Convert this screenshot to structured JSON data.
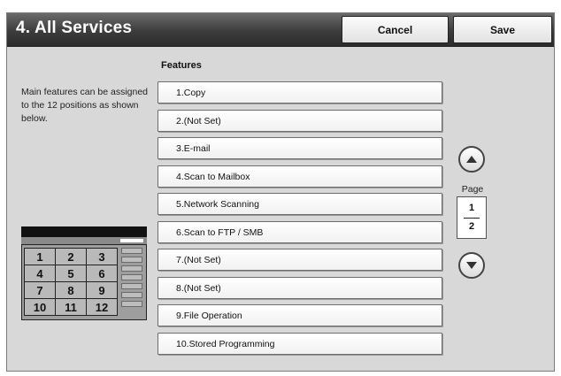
{
  "header": {
    "title": "4. All Services",
    "cancel_label": "Cancel",
    "save_label": "Save"
  },
  "features_label": "Features",
  "description": "Main features can be assigned to the 12 positions as shown below.",
  "features": [
    "1.Copy",
    "2.(Not Set)",
    "3.E-mail",
    "4.Scan to Mailbox",
    "5.Network Scanning",
    "6.Scan to FTP / SMB",
    "7.(Not Set)",
    "8.(Not Set)",
    "9.File Operation",
    "10.Stored Programming"
  ],
  "keypad": {
    "keys": [
      "1",
      "2",
      "3",
      "4",
      "5",
      "6",
      "7",
      "8",
      "9",
      "10",
      "11",
      "12"
    ]
  },
  "paging": {
    "label": "Page",
    "current": "1",
    "total": "2"
  },
  "icons": {
    "up": "arrow-up-icon",
    "down": "arrow-down-icon"
  }
}
